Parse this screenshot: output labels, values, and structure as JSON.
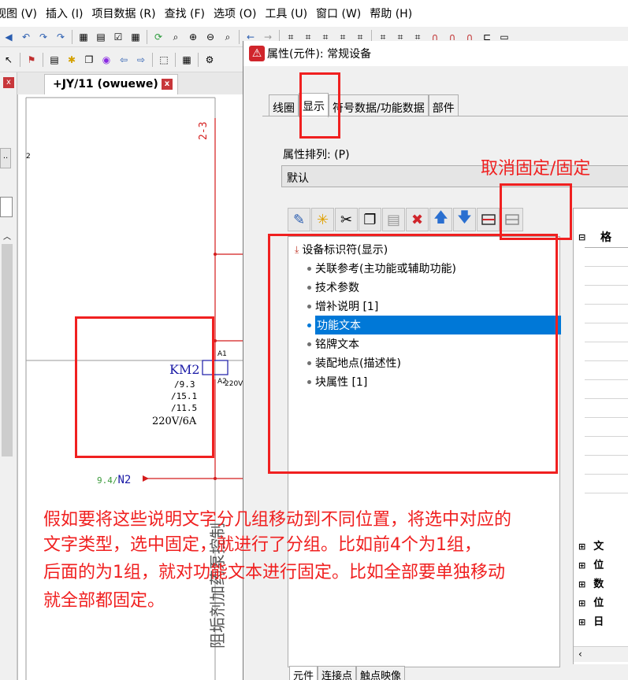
{
  "menubar": {
    "items": [
      "视图 (V)",
      "插入 (I)",
      "项目数据 (R)",
      "查找 (F)",
      "选项 (O)",
      "工具 (U)",
      "窗口 (W)",
      "帮助 (H)"
    ]
  },
  "doc_tab": {
    "title": "+JY/11 (owuewe)"
  },
  "schematic": {
    "ref_top": "2-3",
    "component": "KM2",
    "pin_a1": "A1",
    "pin_a2": "A2",
    "voltage_short": "220V",
    "refs": [
      "/9.3",
      "/15.1",
      "/11.5"
    ],
    "rating": "220V/6A",
    "net_ref": "9.4",
    "net_name": "N2",
    "margin_num": "2",
    "rotated_text": "阻垢剂加药泵控制"
  },
  "dialog": {
    "title": "属性(元件): 常规设备",
    "tabs": [
      "线圈",
      "显示",
      "符号数据/功能数据",
      "部件"
    ],
    "active_tab": "显示",
    "sorting_label": "属性排列: (P)",
    "sorting_value": "默认",
    "tree_items": [
      {
        "label": "设备标识符(显示)",
        "root": true
      },
      {
        "label": "关联参考(主功能或辅助功能)"
      },
      {
        "label": "技术参数"
      },
      {
        "label": "增补说明 [1]"
      },
      {
        "label": "功能文本",
        "selected": true
      },
      {
        "label": "铭牌文本"
      },
      {
        "label": "装配地点(描述性)"
      },
      {
        "label": "块属性 [1]"
      }
    ],
    "right_grid": {
      "header": "格",
      "rows": [
        "文",
        "位",
        "数",
        "位",
        "日"
      ]
    },
    "bottom_tabs": [
      "元件",
      "连接点",
      "触点映像"
    ]
  },
  "annotations": {
    "fix_label": "取消固定/固定",
    "note_lines": [
      "假如要将这些说明文字分几组移动到不同位置，将选中对应的",
      "文字类型，选中固定，就进行了分组。比如前4个为1组，",
      "后面的为1组，就对功能文本进行固定。比如全部要单独移动",
      "就全部都固定。"
    ]
  },
  "colors": {
    "annotation_red": "#f02020",
    "selection_blue": "#0078d7",
    "schematic_red": "#d41c1c",
    "schematic_blue": "#1a1aa6",
    "net_green": "#3a9a3a"
  }
}
